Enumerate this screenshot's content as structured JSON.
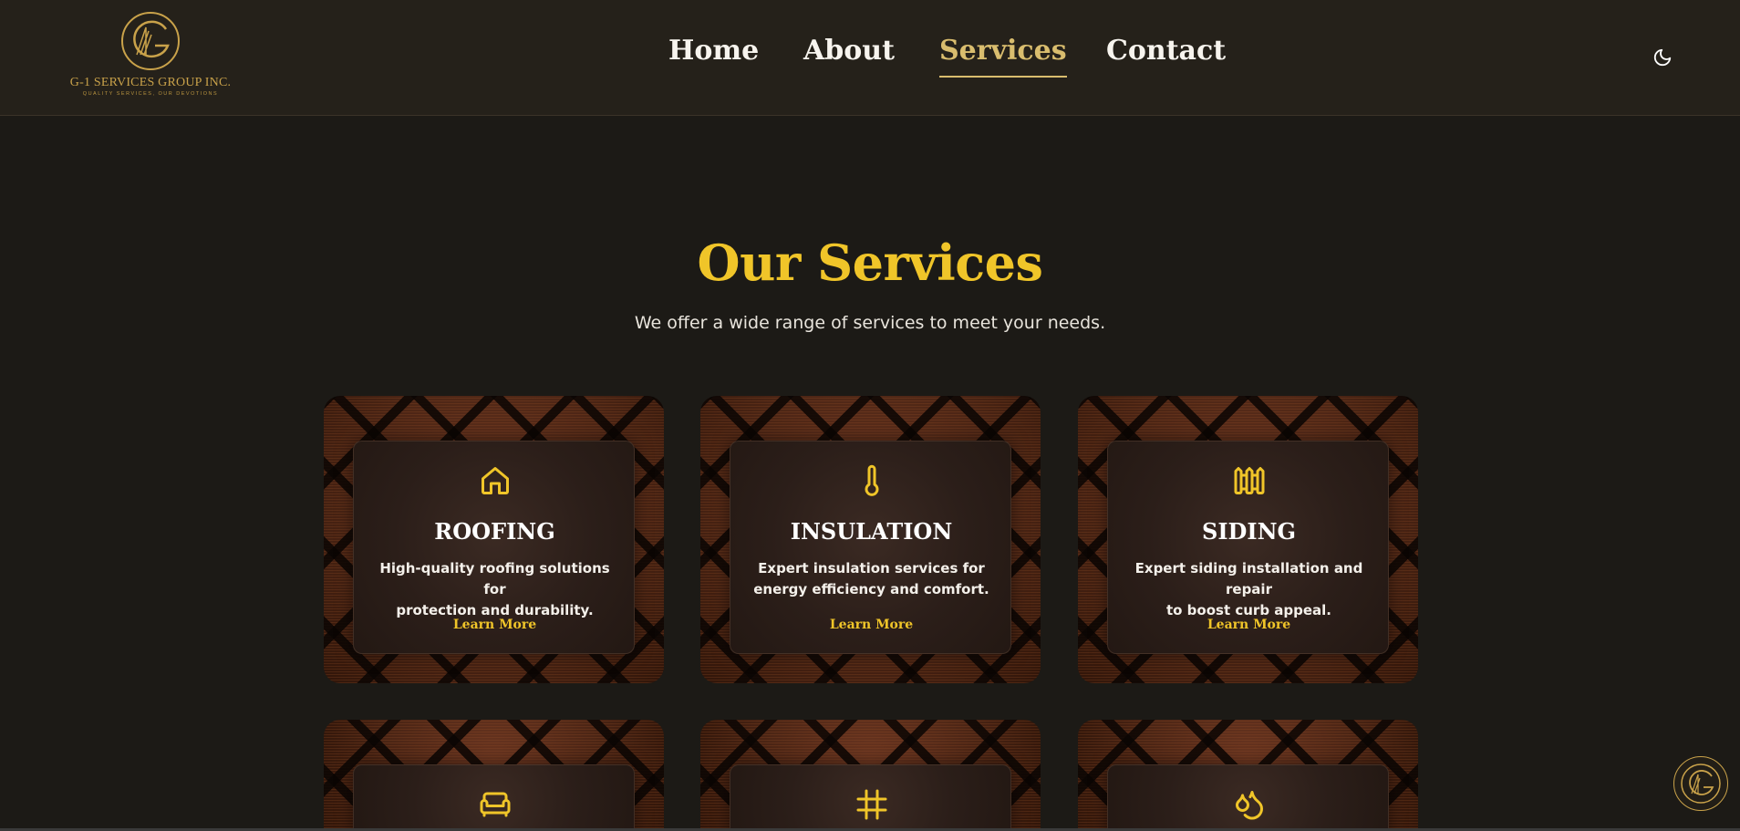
{
  "brand": {
    "name": "G-1 SERVICES GROUP INC.",
    "tagline": "QUALITY SERVICES, OUR DEVOTIONS"
  },
  "nav": {
    "items": [
      {
        "label": "Home",
        "active": false
      },
      {
        "label": "About",
        "active": false
      },
      {
        "label": "Services",
        "active": true
      },
      {
        "label": "Contact",
        "active": false
      }
    ]
  },
  "hero": {
    "title": "Our Services",
    "subtitle": "We offer a wide range of services to meet your needs."
  },
  "services": [
    {
      "icon": "house-icon",
      "title": "ROOFING",
      "desc_line1": "High-quality roofing solutions for",
      "desc_line2": "protection and durability.",
      "link": "Learn More"
    },
    {
      "icon": "thermometer-icon",
      "title": "INSULATION",
      "desc_line1": "Expert insulation services for",
      "desc_line2": "energy efficiency and comfort.",
      "link": "Learn More"
    },
    {
      "icon": "fence-icon",
      "title": "SIDING",
      "desc_line1": "Expert siding installation and repair",
      "desc_line2": "to boost curb appeal.",
      "link": "Learn More"
    },
    {
      "icon": "sofa-icon"
    },
    {
      "icon": "grid-frame-icon"
    },
    {
      "icon": "droplets-icon"
    }
  ],
  "colors": {
    "accent": "#f0c529",
    "gold": "#c9a24a",
    "background": "#1c1a16",
    "header": "#25211a"
  }
}
